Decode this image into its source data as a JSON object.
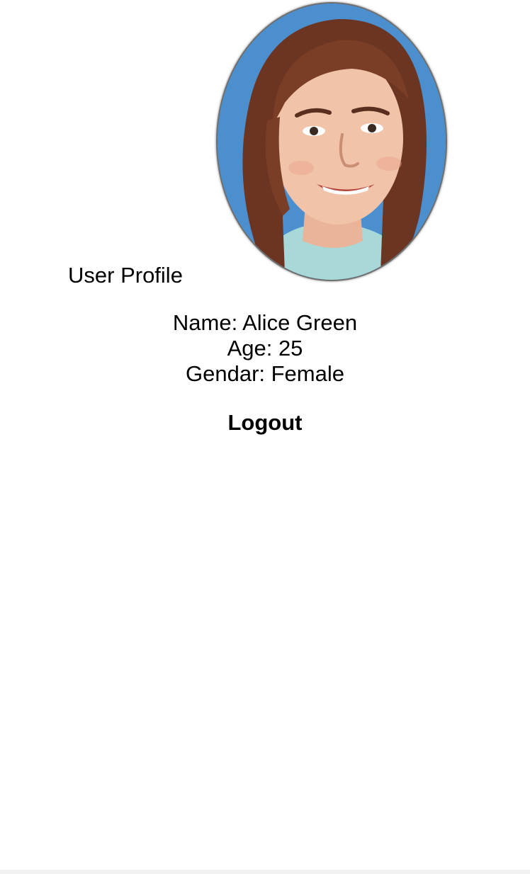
{
  "profile": {
    "title": "User Profile",
    "name_line": "Name: Alice Green",
    "age_line": "Age: 25",
    "gender_line": "Gendar: Female"
  },
  "actions": {
    "logout_label": "Logout"
  },
  "avatar": {
    "description_icon": "user-photo",
    "background_color": "#4b8fcf"
  }
}
